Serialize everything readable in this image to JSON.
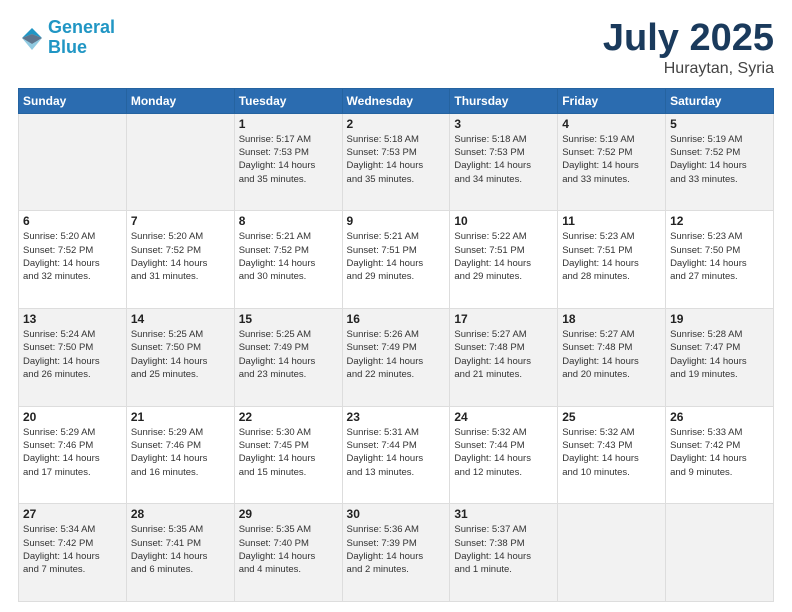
{
  "header": {
    "logo_line1": "General",
    "logo_line2": "Blue",
    "month": "July 2025",
    "location": "Huraytan, Syria"
  },
  "weekdays": [
    "Sunday",
    "Monday",
    "Tuesday",
    "Wednesday",
    "Thursday",
    "Friday",
    "Saturday"
  ],
  "weeks": [
    [
      {
        "day": "",
        "text": ""
      },
      {
        "day": "",
        "text": ""
      },
      {
        "day": "1",
        "text": "Sunrise: 5:17 AM\nSunset: 7:53 PM\nDaylight: 14 hours\nand 35 minutes."
      },
      {
        "day": "2",
        "text": "Sunrise: 5:18 AM\nSunset: 7:53 PM\nDaylight: 14 hours\nand 35 minutes."
      },
      {
        "day": "3",
        "text": "Sunrise: 5:18 AM\nSunset: 7:53 PM\nDaylight: 14 hours\nand 34 minutes."
      },
      {
        "day": "4",
        "text": "Sunrise: 5:19 AM\nSunset: 7:52 PM\nDaylight: 14 hours\nand 33 minutes."
      },
      {
        "day": "5",
        "text": "Sunrise: 5:19 AM\nSunset: 7:52 PM\nDaylight: 14 hours\nand 33 minutes."
      }
    ],
    [
      {
        "day": "6",
        "text": "Sunrise: 5:20 AM\nSunset: 7:52 PM\nDaylight: 14 hours\nand 32 minutes."
      },
      {
        "day": "7",
        "text": "Sunrise: 5:20 AM\nSunset: 7:52 PM\nDaylight: 14 hours\nand 31 minutes."
      },
      {
        "day": "8",
        "text": "Sunrise: 5:21 AM\nSunset: 7:52 PM\nDaylight: 14 hours\nand 30 minutes."
      },
      {
        "day": "9",
        "text": "Sunrise: 5:21 AM\nSunset: 7:51 PM\nDaylight: 14 hours\nand 29 minutes."
      },
      {
        "day": "10",
        "text": "Sunrise: 5:22 AM\nSunset: 7:51 PM\nDaylight: 14 hours\nand 29 minutes."
      },
      {
        "day": "11",
        "text": "Sunrise: 5:23 AM\nSunset: 7:51 PM\nDaylight: 14 hours\nand 28 minutes."
      },
      {
        "day": "12",
        "text": "Sunrise: 5:23 AM\nSunset: 7:50 PM\nDaylight: 14 hours\nand 27 minutes."
      }
    ],
    [
      {
        "day": "13",
        "text": "Sunrise: 5:24 AM\nSunset: 7:50 PM\nDaylight: 14 hours\nand 26 minutes."
      },
      {
        "day": "14",
        "text": "Sunrise: 5:25 AM\nSunset: 7:50 PM\nDaylight: 14 hours\nand 25 minutes."
      },
      {
        "day": "15",
        "text": "Sunrise: 5:25 AM\nSunset: 7:49 PM\nDaylight: 14 hours\nand 23 minutes."
      },
      {
        "day": "16",
        "text": "Sunrise: 5:26 AM\nSunset: 7:49 PM\nDaylight: 14 hours\nand 22 minutes."
      },
      {
        "day": "17",
        "text": "Sunrise: 5:27 AM\nSunset: 7:48 PM\nDaylight: 14 hours\nand 21 minutes."
      },
      {
        "day": "18",
        "text": "Sunrise: 5:27 AM\nSunset: 7:48 PM\nDaylight: 14 hours\nand 20 minutes."
      },
      {
        "day": "19",
        "text": "Sunrise: 5:28 AM\nSunset: 7:47 PM\nDaylight: 14 hours\nand 19 minutes."
      }
    ],
    [
      {
        "day": "20",
        "text": "Sunrise: 5:29 AM\nSunset: 7:46 PM\nDaylight: 14 hours\nand 17 minutes."
      },
      {
        "day": "21",
        "text": "Sunrise: 5:29 AM\nSunset: 7:46 PM\nDaylight: 14 hours\nand 16 minutes."
      },
      {
        "day": "22",
        "text": "Sunrise: 5:30 AM\nSunset: 7:45 PM\nDaylight: 14 hours\nand 15 minutes."
      },
      {
        "day": "23",
        "text": "Sunrise: 5:31 AM\nSunset: 7:44 PM\nDaylight: 14 hours\nand 13 minutes."
      },
      {
        "day": "24",
        "text": "Sunrise: 5:32 AM\nSunset: 7:44 PM\nDaylight: 14 hours\nand 12 minutes."
      },
      {
        "day": "25",
        "text": "Sunrise: 5:32 AM\nSunset: 7:43 PM\nDaylight: 14 hours\nand 10 minutes."
      },
      {
        "day": "26",
        "text": "Sunrise: 5:33 AM\nSunset: 7:42 PM\nDaylight: 14 hours\nand 9 minutes."
      }
    ],
    [
      {
        "day": "27",
        "text": "Sunrise: 5:34 AM\nSunset: 7:42 PM\nDaylight: 14 hours\nand 7 minutes."
      },
      {
        "day": "28",
        "text": "Sunrise: 5:35 AM\nSunset: 7:41 PM\nDaylight: 14 hours\nand 6 minutes."
      },
      {
        "day": "29",
        "text": "Sunrise: 5:35 AM\nSunset: 7:40 PM\nDaylight: 14 hours\nand 4 minutes."
      },
      {
        "day": "30",
        "text": "Sunrise: 5:36 AM\nSunset: 7:39 PM\nDaylight: 14 hours\nand 2 minutes."
      },
      {
        "day": "31",
        "text": "Sunrise: 5:37 AM\nSunset: 7:38 PM\nDaylight: 14 hours\nand 1 minute."
      },
      {
        "day": "",
        "text": ""
      },
      {
        "day": "",
        "text": ""
      }
    ]
  ]
}
